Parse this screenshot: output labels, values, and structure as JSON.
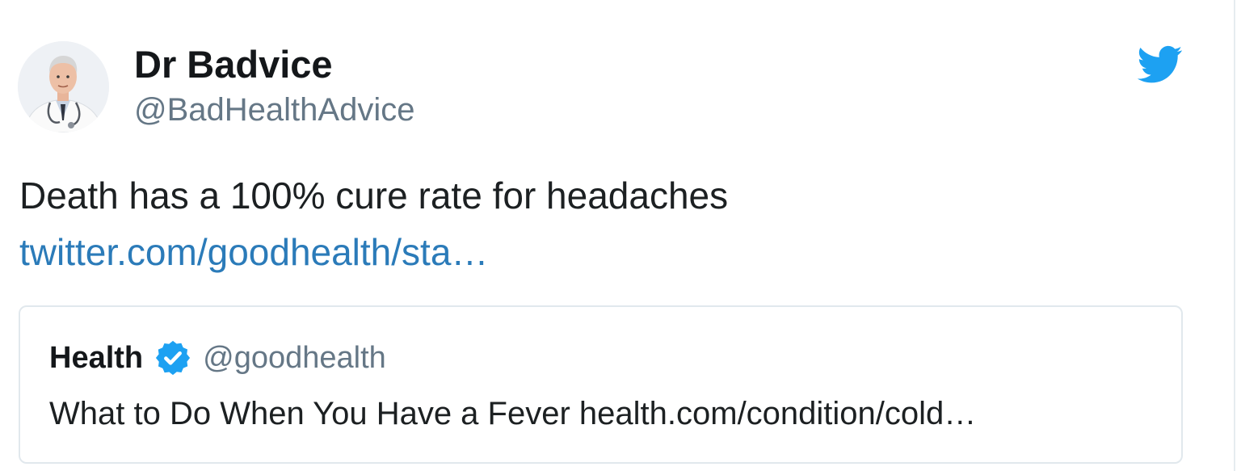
{
  "author": {
    "display_name": "Dr Badvice",
    "handle": "@BadHealthAdvice",
    "avatar_icon": "doctor-avatar"
  },
  "brand": {
    "icon": "twitter-bird-icon",
    "color": "#1da1f2"
  },
  "tweet": {
    "text": "Death has a 100% cure rate for headaches",
    "link": "twitter.com/goodhealth/sta…",
    "link_color": "#2b7bb9"
  },
  "quoted_tweet": {
    "display_name": "Health",
    "verified": true,
    "verified_icon": "verified-badge-icon",
    "handle": "@goodhealth",
    "text": "What to Do When You Have a Fever health.com/condition/cold…"
  },
  "colors": {
    "text_primary": "#14171a",
    "text_secondary": "#657786",
    "border": "#e1e8ed"
  }
}
